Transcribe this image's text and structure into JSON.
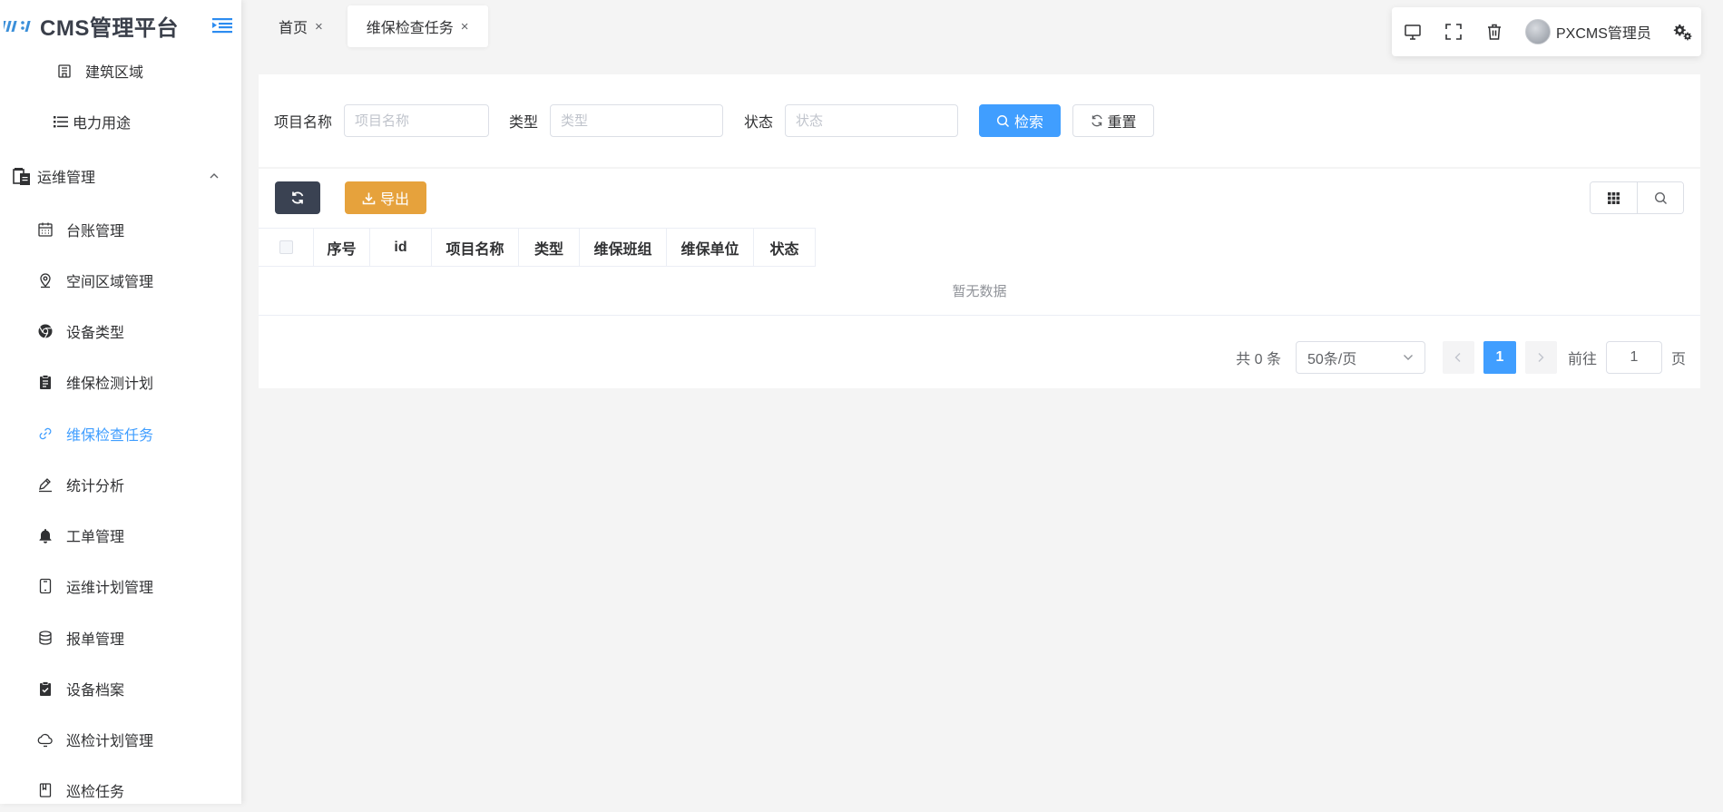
{
  "app": {
    "title": "CMS管理平台",
    "accent_color": "#409eff"
  },
  "sidebar": {
    "items": [
      {
        "label": "建筑区域",
        "icon": "building-icon",
        "level": "sub-top"
      },
      {
        "label": "电力用途",
        "icon": "list-icon",
        "level": "sub-top"
      },
      {
        "label": "运维管理",
        "icon": "clipboard-copy-icon",
        "level": "group",
        "expanded": true
      },
      {
        "label": "台账管理",
        "icon": "calendar-icon",
        "level": "sub"
      },
      {
        "label": "空间区域管理",
        "icon": "location-icon",
        "level": "sub"
      },
      {
        "label": "设备类型",
        "icon": "chrome-icon",
        "level": "sub"
      },
      {
        "label": "维保检测计划",
        "icon": "clipboard-icon",
        "level": "sub"
      },
      {
        "label": "维保检查任务",
        "icon": "link-icon",
        "level": "sub",
        "active": true
      },
      {
        "label": "统计分析",
        "icon": "edit-icon",
        "level": "sub"
      },
      {
        "label": "工单管理",
        "icon": "bell-icon",
        "level": "sub"
      },
      {
        "label": "运维计划管理",
        "icon": "tablet-icon",
        "level": "sub"
      },
      {
        "label": "报单管理",
        "icon": "coin-icon",
        "level": "sub"
      },
      {
        "label": "设备档案",
        "icon": "clipboard-check-icon",
        "level": "sub"
      },
      {
        "label": "巡检计划管理",
        "icon": "cloud-icon",
        "level": "sub"
      },
      {
        "label": "巡检任务",
        "icon": "notebook-icon",
        "level": "sub"
      }
    ]
  },
  "tabs": [
    {
      "label": "首页",
      "close": "×"
    },
    {
      "label": "维保检查任务",
      "close": "×",
      "active": true
    }
  ],
  "toolbar": {
    "icons": [
      "monitor-icon",
      "fullscreen-icon",
      "trash-icon"
    ],
    "username": "PXCMS管理员"
  },
  "search": {
    "fields": [
      {
        "label": "项目名称",
        "placeholder": "项目名称"
      },
      {
        "label": "类型",
        "placeholder": "类型"
      },
      {
        "label": "状态",
        "placeholder": "状态"
      }
    ],
    "search_label": "检索",
    "reset_label": "重置"
  },
  "table": {
    "export_label": "导出",
    "columns": [
      "序号",
      "id",
      "项目名称",
      "类型",
      "维保班组",
      "维保单位",
      "状态"
    ],
    "empty_text": "暂无数据"
  },
  "pagination": {
    "total": "共 0 条",
    "page_size": "50条/页",
    "current_page": "1",
    "goto_label": "前往",
    "goto_value": "1",
    "page_suffix": "页"
  }
}
